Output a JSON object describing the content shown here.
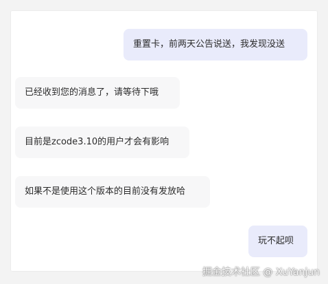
{
  "messages": [
    {
      "role": "user",
      "text": "重置卡，前两天公告说送，我发现没送"
    },
    {
      "role": "assistant",
      "text": "已经收到您的消息了，请等待下哦"
    },
    {
      "role": "assistant",
      "text": "目前是zcode3.10的用户才会有影响"
    },
    {
      "role": "assistant",
      "text": "如果不是使用这个版本的目前没有发放哈"
    },
    {
      "role": "user",
      "text": "玩不起呗"
    }
  ],
  "watermark": "掘金技术社区 @ XuYanjun",
  "colors": {
    "user_bubble": "#e9ebfb",
    "assistant_bubble": "#f7f7f8",
    "text": "#2b2b2b"
  }
}
